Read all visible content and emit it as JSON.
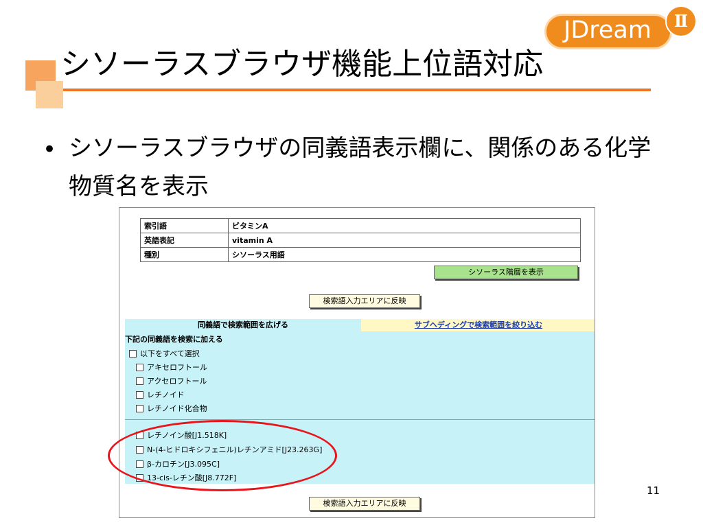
{
  "slide": {
    "title": "シソーラスブラウザ機能上位語対応",
    "bullet": "シソーラスブラウザの同義語表示欄に、関係のある化学物質名を表示",
    "page_number": "11",
    "accent_color": "#ee7622"
  },
  "logo": {
    "text": "JDream",
    "badge": "Ⅱ"
  },
  "screenshot": {
    "info_rows": [
      {
        "key": "索引語",
        "value": "ビタミンA"
      },
      {
        "key": "英語表記",
        "value": "vitamin A"
      },
      {
        "key": "種別",
        "value": "シソーラス用語"
      }
    ],
    "show_hierarchy_button": "シソーラス階層を表示",
    "reflect_button": "検索語入力エリアに反映",
    "reflect_button_bottom": "検索語入力エリアに反映",
    "tab_broaden": "同義語で検索範囲を広げる",
    "tab_narrow": "サブヘディングで検索範囲を絞り込む",
    "add_synonyms_label": "下記の同義語を検索に加える",
    "select_all": "以下をすべて選択",
    "synonyms": [
      "アキセロフトール",
      "アクセロフトール",
      "レチノイド",
      "レチノイド化合物"
    ],
    "related_chemicals": [
      "レチノイン酸[J1.518K]",
      "N-(4-ヒドロキシフェニル)レチンアミド[J23.263G]",
      "β-カロチン[J3.095C]",
      "13-cis-レチン酸[J8.772F]"
    ]
  }
}
